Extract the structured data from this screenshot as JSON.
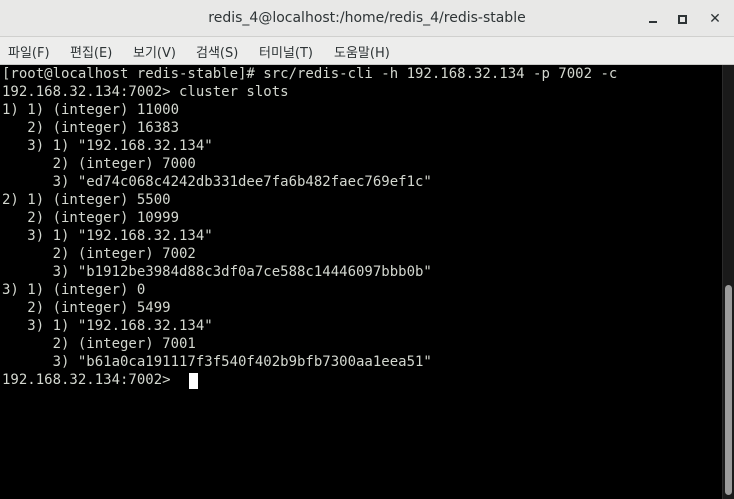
{
  "window": {
    "title": "redis_4@localhost:/home/redis_4/redis-stable",
    "minimize_label": "",
    "maximize_label": "",
    "close_label": "✕"
  },
  "menu": [
    {
      "label": "파일(F)"
    },
    {
      "label": "편집(E)"
    },
    {
      "label": "보기(V)"
    },
    {
      "label": "검색(S)"
    },
    {
      "label": "터미널(T)"
    },
    {
      "label": "도움말(H)"
    }
  ],
  "terminal": {
    "lines": [
      "[root@localhost redis-stable]# src/redis-cli -h 192.168.32.134 -p 7002 -c",
      "192.168.32.134:7002> cluster slots",
      "1) 1) (integer) 11000",
      "   2) (integer) 16383",
      "   3) 1) \"192.168.32.134\"",
      "      2) (integer) 7000",
      "      3) \"ed74c068c4242db331dee7fa6b482faec769ef1c\"",
      "2) 1) (integer) 5500",
      "   2) (integer) 10999",
      "   3) 1) \"192.168.32.134\"",
      "      2) (integer) 7002",
      "      3) \"b1912be3984d88c3df0a7ce588c14446097bbb0b\"",
      "3) 1) (integer) 0",
      "   2) (integer) 5499",
      "   3) 1) \"192.168.32.134\"",
      "      2) (integer) 7001",
      "      3) \"b61a0ca191117f3f540f402b9bfb7300aa1eea51\"",
      "192.168.32.134:7002> "
    ]
  },
  "colors": {
    "terminal_bg": "#000000",
    "terminal_fg": "#d3d7cf",
    "titlebar_bg": "#e8e8e7",
    "menubar_bg": "#ededec"
  }
}
